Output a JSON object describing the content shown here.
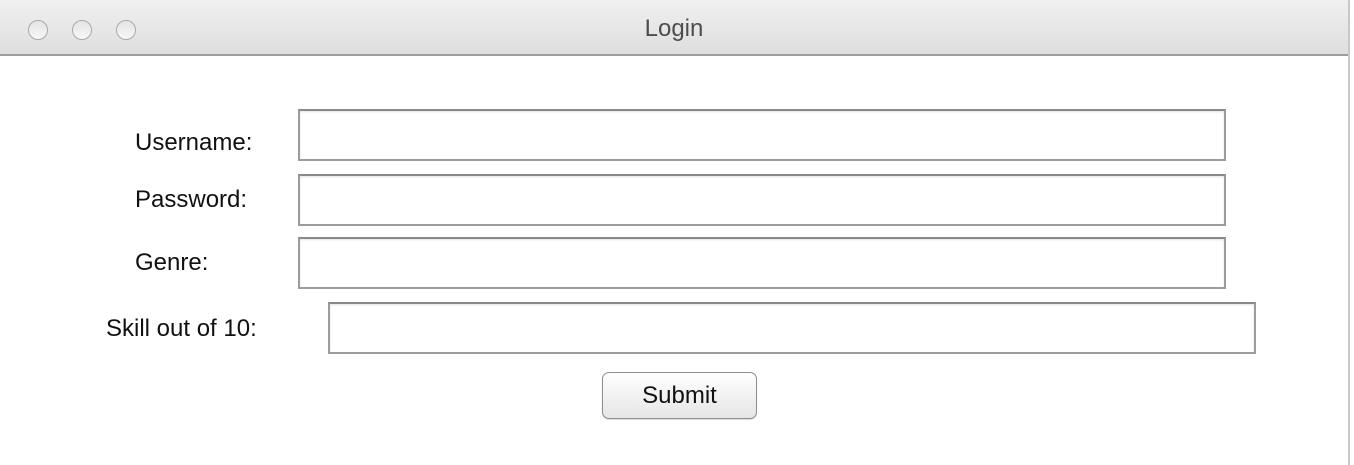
{
  "window": {
    "title": "Login"
  },
  "form": {
    "username": {
      "label": "Username:",
      "value": "",
      "placeholder": ""
    },
    "password": {
      "label": "Password:",
      "value": "",
      "placeholder": ""
    },
    "genre": {
      "label": "Genre:",
      "value": "",
      "placeholder": ""
    },
    "skill": {
      "label": "Skill out of 10:",
      "value": "",
      "placeholder": ""
    },
    "submit_label": "Submit"
  },
  "icons": {
    "close": "traffic-light-close-icon",
    "minimize": "traffic-light-minimize-icon",
    "zoom": "traffic-light-zoom-icon"
  }
}
